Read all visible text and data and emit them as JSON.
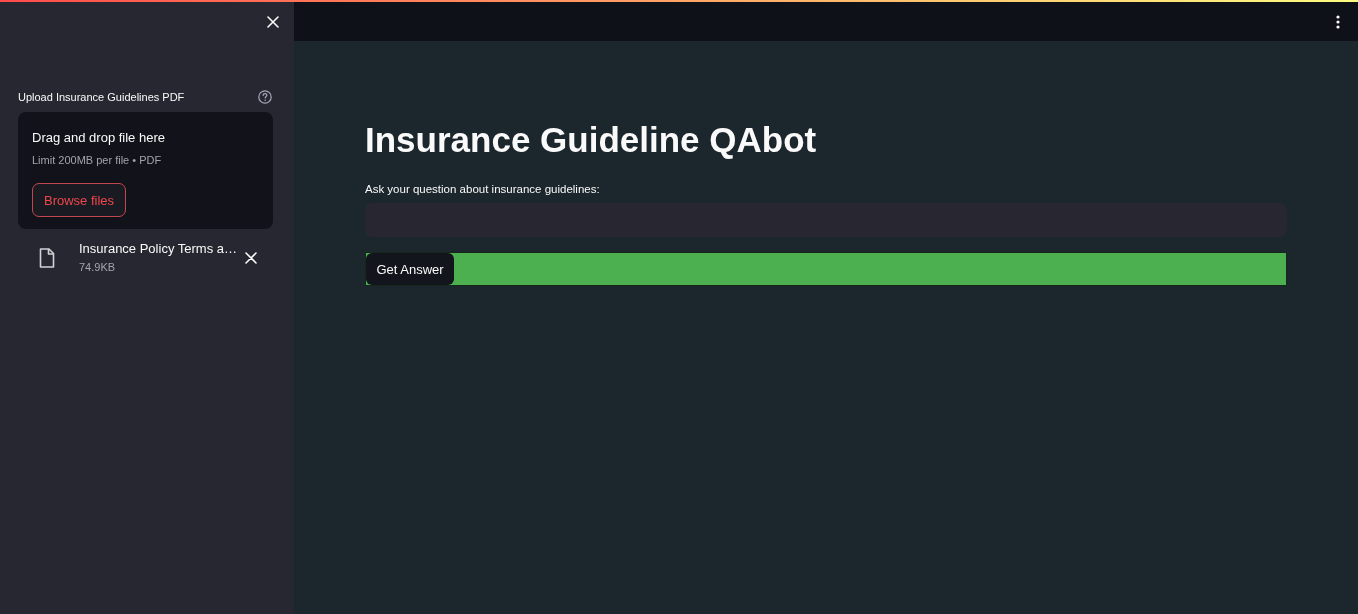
{
  "sidebar": {
    "uploader": {
      "label": "Upload Insurance Guidelines PDF",
      "dropzone_title": "Drag and drop file here",
      "dropzone_hint": "Limit 200MB per file • PDF",
      "browse_button": "Browse files"
    },
    "files": [
      {
        "name": "Insurance Policy Terms a…",
        "size": "74.9KB"
      }
    ]
  },
  "main": {
    "title": "Insurance Guideline QAbot",
    "question": {
      "label": "Ask your question about insurance guidelines:"
    },
    "submit_button": "Get Answer"
  }
}
